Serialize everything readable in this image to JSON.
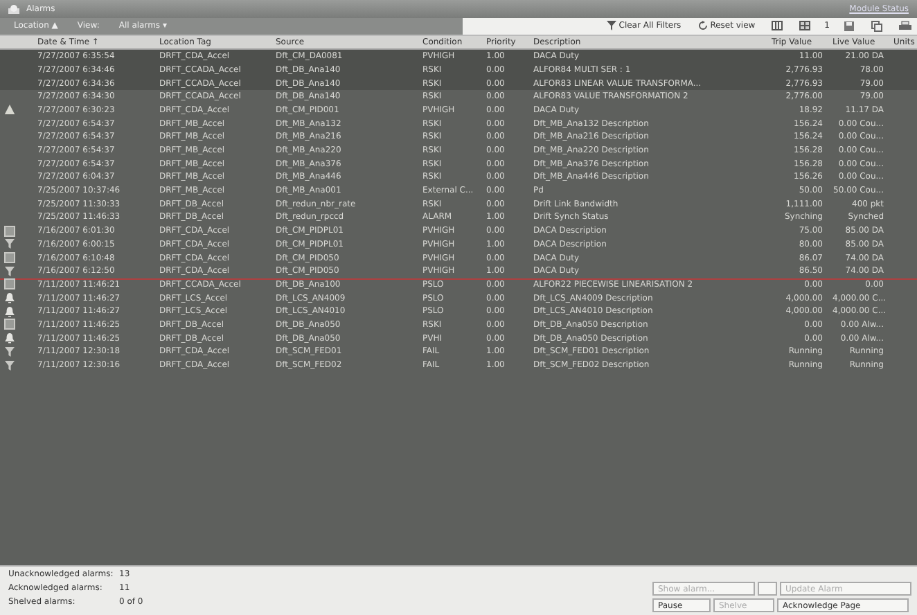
{
  "window": {
    "title": "Alarms",
    "module": "Module Status"
  },
  "toolbar": {
    "location": "Location ▲",
    "view_label": "View:",
    "view": "All alarms ▾",
    "clear": "Clear All Filters",
    "reset": "Reset view",
    "counter": "1"
  },
  "table": {
    "columns": [
      "Date & Time ↑",
      "Location Tag",
      "Source",
      "Condition",
      "Priority",
      "Description",
      "Trip Value",
      "Live Value",
      "Units"
    ],
    "rows": [
      {
        "kind": "plain",
        "selected": true,
        "divider_above": false,
        "cells": [
          "7/27/2007 6:35:54",
          "DRFT_CDA_Accel",
          "Dft_CM_DA0081",
          "PVHIGH",
          "1.00",
          "DACA Duty",
          "11.00",
          "21.00 DA"
        ]
      },
      {
        "kind": "plain",
        "selected": true,
        "divider_above": false,
        "cells": [
          "7/27/2007 6:34:46",
          "DRFT_CCADA_Accel",
          "Dft_DB_Ana140",
          "RSKI",
          "0.00",
          "ALFOR84 MULTI SER : 1",
          "2,776.93",
          "78.00"
        ]
      },
      {
        "kind": "plain",
        "selected": true,
        "divider_above": false,
        "cells": [
          "7/27/2007 6:34:36",
          "DRFT_CCADA_Accel",
          "Dft_DB_Ana140",
          "RSKI",
          "0.00",
          "ALFOR83 LINEAR VALUE TRANSFORMA...",
          "2,776.93",
          "79.00"
        ]
      },
      {
        "kind": "plain",
        "selected": false,
        "divider_above": false,
        "cells": [
          "7/27/2007 6:34:30",
          "DRFT_CCADA_Accel",
          "Dft_DB_Ana140",
          "RSKI",
          "0.00",
          "ALFOR83 VALUE TRANSFORMATION 2",
          "2,776.00",
          "79.00"
        ]
      },
      {
        "kind": "warning",
        "selected": false,
        "divider_above": false,
        "cells": [
          "7/27/2007 6:30:23",
          "DRFT_CDA_Accel",
          "Dft_CM_PID001",
          "PVHIGH",
          "0.00",
          "DACA Duty",
          "18.92",
          "11.17 DA"
        ]
      },
      {
        "kind": "plain",
        "selected": false,
        "divider_above": false,
        "cells": [
          "7/27/2007 6:54:37",
          "DRFT_MB_Accel",
          "Dft_MB_Ana132",
          "RSKI",
          "0.00",
          "Dft_MB_Ana132 Description",
          "156.24",
          "0.00 Cou..."
        ]
      },
      {
        "kind": "plain",
        "selected": false,
        "divider_above": false,
        "cells": [
          "7/27/2007 6:54:37",
          "DRFT_MB_Accel",
          "Dft_MB_Ana216",
          "RSKI",
          "0.00",
          "Dft_MB_Ana216 Description",
          "156.24",
          "0.00 Cou..."
        ]
      },
      {
        "kind": "plain",
        "selected": false,
        "divider_above": false,
        "cells": [
          "7/27/2007 6:54:37",
          "DRFT_MB_Accel",
          "Dft_MB_Ana220",
          "RSKI",
          "0.00",
          "Dft_MB_Ana220 Description",
          "156.28",
          "0.00 Cou..."
        ]
      },
      {
        "kind": "plain",
        "selected": false,
        "divider_above": false,
        "cells": [
          "7/27/2007 6:54:37",
          "DRFT_MB_Accel",
          "Dft_MB_Ana376",
          "RSKI",
          "0.00",
          "Dft_MB_Ana376 Description",
          "156.28",
          "0.00 Cou..."
        ]
      },
      {
        "kind": "plain",
        "selected": false,
        "divider_above": false,
        "cells": [
          "7/27/2007 6:04:37",
          "DRFT_MB_Accel",
          "Dft_MB_Ana446",
          "RSKI",
          "0.00",
          "Dft_MB_Ana446 Description",
          "156.26",
          "0.00 Cou..."
        ]
      },
      {
        "kind": "plain",
        "selected": false,
        "divider_above": false,
        "cells": [
          "7/25/2007 10:37:46",
          "DRFT_MB_Accel",
          "Dft_MB_Ana001",
          "External C...",
          "0.00",
          "Pd",
          "50.00",
          "50.00 Cou..."
        ]
      },
      {
        "kind": "plain",
        "selected": false,
        "divider_above": false,
        "cells": [
          "7/25/2007 11:30:33",
          "DRFT_DB_Accel",
          "Dft_redun_nbr_rate",
          "RSKI",
          "0.00",
          "Drift Link Bandwidth",
          "1,111.00",
          "400 pkt"
        ]
      },
      {
        "kind": "plain",
        "selected": false,
        "divider_above": false,
        "cells": [
          "7/25/2007 11:46:33",
          "DRFT_DB_Accel",
          "Dft_redun_rpccd",
          "ALARM",
          "1.00",
          "Drift Synch Status",
          "Synching",
          "Synched"
        ]
      },
      {
        "kind": "square",
        "selected": false,
        "divider_above": false,
        "cells": [
          "7/16/2007 6:01:30",
          "DRFT_CDA_Accel",
          "Dft_CM_PIDPL01",
          "PVHIGH",
          "0.00",
          "DACA Description",
          "75.00",
          "85.00 DA"
        ]
      },
      {
        "kind": "filter",
        "selected": false,
        "divider_above": false,
        "cells": [
          "7/16/2007 6:00:15",
          "DRFT_CDA_Accel",
          "Dft_CM_PIDPL01",
          "PVHIGH",
          "1.00",
          "DACA Description",
          "80.00",
          "85.00 DA"
        ]
      },
      {
        "kind": "square",
        "selected": false,
        "divider_above": false,
        "cells": [
          "7/16/2007 6:10:48",
          "DRFT_CDA_Accel",
          "Dft_CM_PID050",
          "PVHIGH",
          "0.00",
          "DACA Duty",
          "86.07",
          "74.00 DA"
        ]
      },
      {
        "kind": "filter",
        "selected": false,
        "divider_above": false,
        "cells": [
          "7/16/2007 6:12:50",
          "DRFT_CDA_Accel",
          "Dft_CM_PID050",
          "PVHIGH",
          "1.00",
          "DACA Duty",
          "86.50",
          "74.00 DA"
        ]
      },
      {
        "kind": "square",
        "selected": false,
        "divider_above": true,
        "cells": [
          "7/11/2007 11:46:21",
          "DRFT_CCADA_Accel",
          "Dft_DB_Ana100",
          "PSLO",
          "0.00",
          "ALFOR22 PIECEWISE LINEARISATION 2",
          "0.00",
          "0.00"
        ]
      },
      {
        "kind": "bell",
        "selected": false,
        "divider_above": false,
        "cells": [
          "7/11/2007 11:46:27",
          "DRFT_LCS_Accel",
          "Dft_LCS_AN4009",
          "PSLO",
          "0.00",
          "Dft_LCS_AN4009 Description",
          "4,000.00",
          "4,000.00 C..."
        ]
      },
      {
        "kind": "bell",
        "selected": false,
        "divider_above": false,
        "cells": [
          "7/11/2007 11:46:27",
          "DRFT_LCS_Accel",
          "Dft_LCS_AN4010",
          "PSLO",
          "0.00",
          "Dft_LCS_AN4010 Description",
          "4,000.00",
          "4,000.00 C..."
        ]
      },
      {
        "kind": "square",
        "selected": false,
        "divider_above": false,
        "cells": [
          "7/11/2007 11:46:25",
          "DRFT_DB_Accel",
          "Dft_DB_Ana050",
          "RSKI",
          "0.00",
          "Dft_DB_Ana050 Description",
          "0.00",
          "0.00 Alw..."
        ]
      },
      {
        "kind": "bell",
        "selected": false,
        "divider_above": false,
        "cells": [
          "7/11/2007 11:46:25",
          "DRFT_DB_Accel",
          "Dft_DB_Ana050",
          "PVHI",
          "0.00",
          "Dft_DB_Ana050 Description",
          "0.00",
          "0.00 Alw..."
        ]
      },
      {
        "kind": "filter",
        "selected": false,
        "divider_above": false,
        "cells": [
          "7/11/2007 12:30:18",
          "DRFT_CDA_Accel",
          "Dft_SCM_FED01",
          "FAIL",
          "1.00",
          "Dft_SCM_FED01 Description",
          "Running",
          "Running"
        ]
      },
      {
        "kind": "filter",
        "selected": false,
        "divider_above": false,
        "cells": [
          "7/11/2007 12:30:16",
          "DRFT_CDA_Accel",
          "Dft_SCM_FED02",
          "FAIL",
          "1.00",
          "Dft_SCM_FED02 Description",
          "Running",
          "Running"
        ]
      }
    ]
  },
  "summary": [
    {
      "label": "Unacknowledged alarms:",
      "value": "13"
    },
    {
      "label": "Acknowledged alarms:",
      "value": "11"
    },
    {
      "label": "Shelved alarms:",
      "value": "0  of  0"
    }
  ],
  "actions": [
    {
      "label": "Show alarm...",
      "disabled": true
    },
    {
      "label": "Update Alarm",
      "disabled": true
    },
    {
      "label": "Pause",
      "disabled": false
    },
    {
      "label": "Shelve",
      "disabled": true
    },
    {
      "label": "Acknowledge Page",
      "disabled": false
    }
  ]
}
